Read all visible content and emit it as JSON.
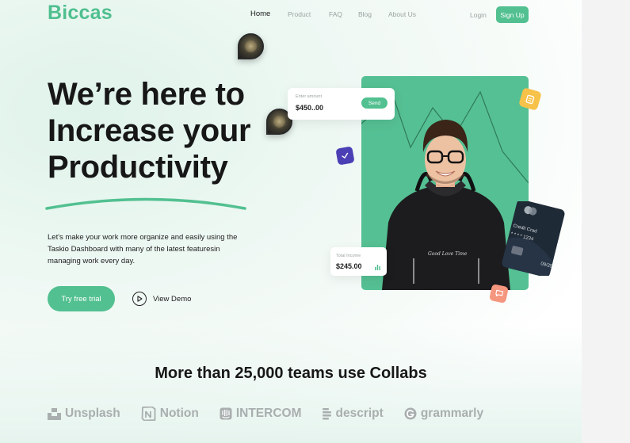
{
  "brand": {
    "name": "Biccas"
  },
  "nav": {
    "items": [
      {
        "label": "Home",
        "active": true
      },
      {
        "label": "Product",
        "active": false
      },
      {
        "label": "FAQ",
        "active": false
      },
      {
        "label": "Blog",
        "active": false
      },
      {
        "label": "About Us",
        "active": false
      }
    ],
    "login": "Login",
    "signup": "Sign Up"
  },
  "hero": {
    "headline": [
      "We’re here to",
      "Increase your",
      "Productivity"
    ],
    "description": "Let's make your work more organize and easily using the Taskio Dashboard with many of the latest featuresin managing work every day.",
    "primary_cta": "Try free trial",
    "secondary_cta": "View Demo"
  },
  "amount_card": {
    "label": "Enter amount",
    "value": "$450..00",
    "button": "Send"
  },
  "income_card": {
    "label": "Total Income",
    "value": "$245.00"
  },
  "credit_card": {
    "label": "Credit Crad",
    "number": "* * * *  1234",
    "expiry": "09/25"
  },
  "teams": {
    "title": "More than 25,000 teams use Collabs"
  },
  "partners": [
    {
      "name": "Unsplash",
      "icon": "unsplash-icon"
    },
    {
      "name": "Notion",
      "icon": "notion-icon"
    },
    {
      "name": "INTERCOM",
      "icon": "intercom-icon"
    },
    {
      "name": "descript",
      "icon": "descript-icon"
    },
    {
      "name": "grammarly",
      "icon": "grammarly-icon"
    }
  ],
  "colors": {
    "accent": "#52c090",
    "heading": "#171717",
    "muted": "#9aa3a0",
    "card_dark": "#1f2a37",
    "badge_yellow": "#f7c24a",
    "badge_purple": "#4b3fb5",
    "badge_coral": "#f5967e"
  }
}
